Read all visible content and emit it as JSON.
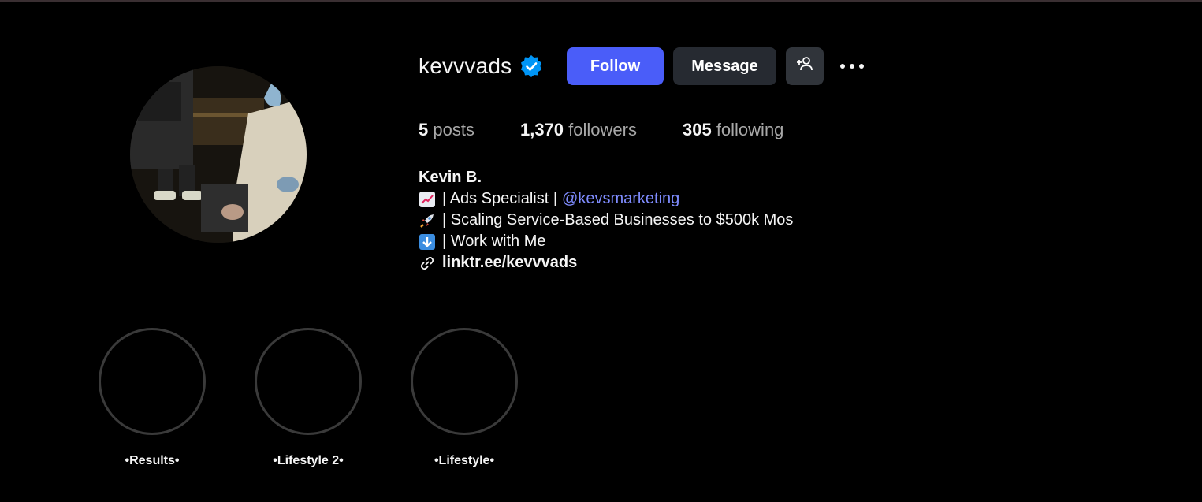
{
  "profile": {
    "username": "kevvvads",
    "verified_icon": "verified-badge-icon",
    "follow_label": "Follow",
    "message_label": "Message",
    "suggest_icon": "add-person-icon",
    "more_icon": "more-options-icon"
  },
  "stats": {
    "posts_count": "5",
    "posts_label": "posts",
    "followers_count": "1,370",
    "followers_label": "followers",
    "following_count": "305",
    "following_label": "following"
  },
  "bio": {
    "name": "Kevin B.",
    "line1_icon": "chart-increasing-emoji",
    "line1_text": "| Ads Specialist |",
    "line1_mention": "@kevsmarketing",
    "line2_icon": "rocket-emoji",
    "line2_text": "| Scaling Service-Based Businesses to $500k Mos",
    "line3_icon": "down-arrow-emoji",
    "line3_text": "| Work with Me",
    "link_icon": "link-icon",
    "link_text": "linktr.ee/kevvvads"
  },
  "highlights": [
    {
      "label": "•Results•"
    },
    {
      "label": "•Lifestyle 2•"
    },
    {
      "label": "•Lifestyle•"
    }
  ],
  "colors": {
    "background": "#000000",
    "follow_button": "#4a5df9",
    "message_button": "#262a31",
    "mention": "#7f8cff",
    "verified": "#0095f6"
  }
}
